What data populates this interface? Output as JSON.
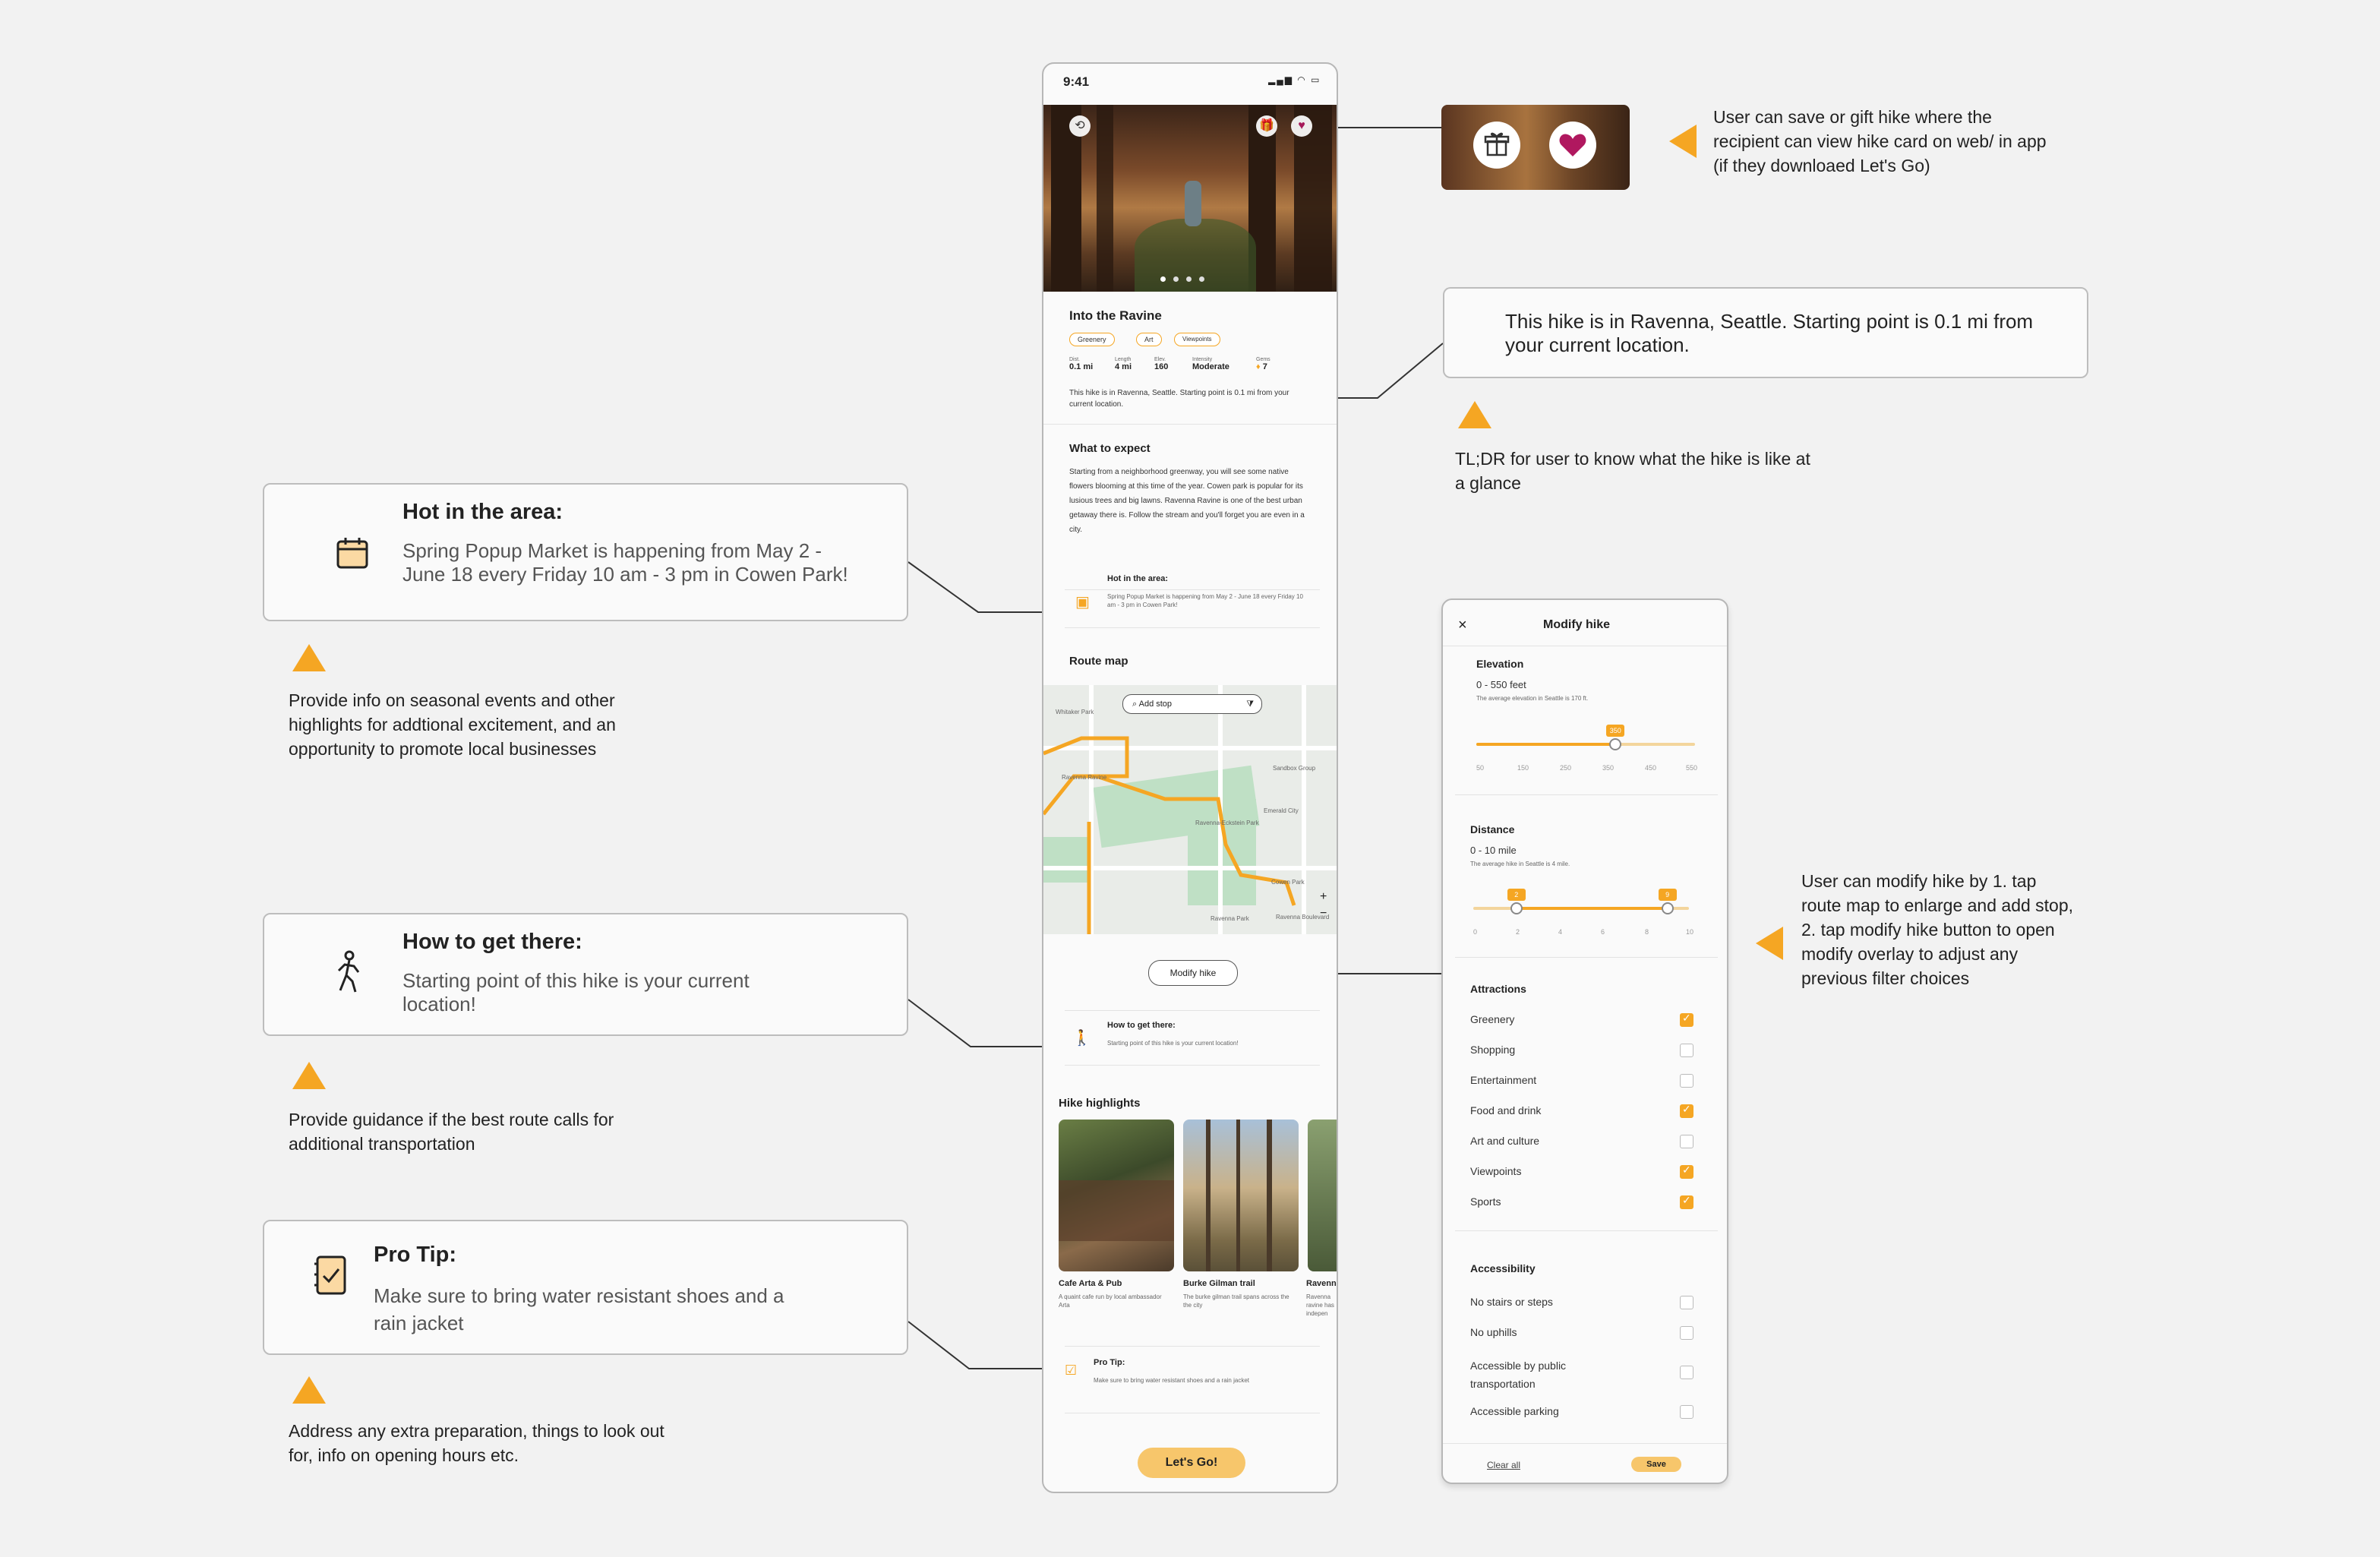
{
  "phone": {
    "status_time": "9:41",
    "hike_title": "Into the Ravine",
    "tags": [
      "Greenery",
      "Art",
      "Viewpoints"
    ],
    "stats": [
      {
        "label": "Dist.",
        "value": "0.1 mi"
      },
      {
        "label": "Length",
        "value": "4 mi"
      },
      {
        "label": "Elev.",
        "value": "160"
      },
      {
        "label": "Intensity",
        "value": "Moderate"
      },
      {
        "label": "Gems",
        "value": "7"
      }
    ],
    "summary": "This hike is in Ravenna, Seattle. Starting point is 0.1 mi from your current location.",
    "what_to_expect_title": "What to expect",
    "what_to_expect_body": "Starting from a neighborhood greenway, you will see some native flowers blooming at this time of the year. Cowen park is popular for its lusious trees and big lawns. Ravenna Ravine is one of the best urban getaway there is. Follow the stream and you'll forget you are even in a city.",
    "hot_title": "Hot in the area:",
    "hot_body": "Spring Popup Market is happening from May 2 - June 18 every Friday 10 am - 3 pm in Cowen Park!",
    "route_map_title": "Route map",
    "add_stop_label": "Add stop",
    "map_labels": [
      "Whitaker Park",
      "Ravenna Ravine",
      "Ravenna Park",
      "Ravenna-Eckstein Park",
      "Cowen Park",
      "Sandbox Group",
      "Emerald City",
      "Ravenna Boulevard"
    ],
    "modify_button": "Modify hike",
    "getting_there_title": "How to get there:",
    "getting_there_body": "Starting point of this hike is your current location!",
    "highlights_title": "Hike highlights",
    "highlights": [
      {
        "name": "Cafe Arta & Pub",
        "desc": "A quaint cafe run by local ambassador Arta"
      },
      {
        "name": "Burke Gilman trail",
        "desc": "The burke gilman trail spans across the the city"
      },
      {
        "name": "Ravenn",
        "desc": "Ravenna ravine has indepen"
      }
    ],
    "protip_title": "Pro Tip:",
    "protip_body": "Make sure to bring water resistant shoes and a rain jacket",
    "go_button": "Let's Go!"
  },
  "annotations": {
    "save_gift": "User can save or gift hike where the recipient can view hike card on web/ in app (if they downloaed Let's Go)",
    "summary_callout": "This hike is in Ravenna, Seattle. Starting point is 0.1 mi from your current location.",
    "tldr": "TL;DR for user to know what the hike is like at a glance",
    "hot_title": "Hot in the area:",
    "hot_body": "Spring Popup Market is happening from May 2 - June 18 every Friday 10 am - 3 pm in Cowen Park!",
    "hot_note": "Provide info on seasonal events and other highlights for addtional excitement, and an opportunity to promote local businesses",
    "getting_title": "How to get there:",
    "getting_body": "Starting point of this hike is your current location!",
    "getting_note": "Provide guidance if the best route calls for additional transportation",
    "protip_title": "Pro Tip:",
    "protip_body": "Make sure to bring water resistant shoes and a rain jacket",
    "protip_note": "Address any extra preparation, things to look out for, info on opening hours etc.",
    "modify_note": "User can modify hike by 1. tap route map to enlarge and add stop, 2. tap modify hike button to open modify overlay to adjust any previous filter choices"
  },
  "modify": {
    "title": "Modify hike",
    "elevation_label": "Elevation",
    "elevation_range": "0 - 550 feet",
    "elevation_hint": "The average elevation in Seattle is 170 ft.",
    "elevation_value": 350,
    "elevation_max": 550,
    "elevation_ticks": [
      "50",
      "150",
      "250",
      "350",
      "450",
      "550"
    ],
    "distance_label": "Distance",
    "distance_range": "0 - 10 mile",
    "distance_hint": "The average hike in Seattle is 4 mile.",
    "distance_low": 2,
    "distance_high": 9,
    "distance_ticks": [
      "0",
      "2",
      "4",
      "6",
      "8",
      "10"
    ],
    "attractions_label": "Attractions",
    "attractions": [
      {
        "label": "Greenery",
        "checked": true
      },
      {
        "label": "Shopping",
        "checked": false
      },
      {
        "label": "Entertainment",
        "checked": false
      },
      {
        "label": "Food and drink",
        "checked": true
      },
      {
        "label": "Art and culture",
        "checked": false
      },
      {
        "label": "Viewpoints",
        "checked": true
      },
      {
        "label": "Sports",
        "checked": true
      }
    ],
    "accessibility_label": "Accessibility",
    "accessibility": [
      {
        "label": "No stairs or steps",
        "checked": false
      },
      {
        "label": "No uphills",
        "checked": false
      },
      {
        "label": "Accessible by public transportation",
        "checked": false
      },
      {
        "label": "Accessible parking",
        "checked": false
      }
    ],
    "clear_label": "Clear all",
    "save_label": "Save"
  },
  "colors": {
    "accent": "#f5a623",
    "heart": "#b0185f"
  }
}
